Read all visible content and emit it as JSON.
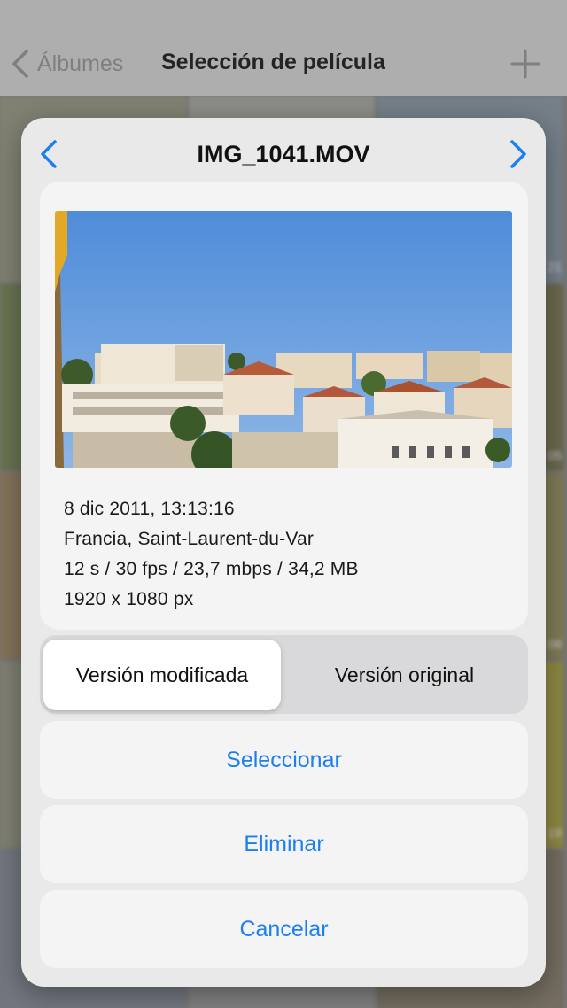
{
  "navbar": {
    "back_label": "Álbumes",
    "title": "Selección de película"
  },
  "background": {
    "labels": [
      "21",
      "05",
      "08",
      "19"
    ]
  },
  "modal": {
    "filename": "IMG_1041.MOV",
    "info": {
      "date": "8 dic 2011, 13:13:16",
      "location": "Francia, Saint-Laurent-du-Var",
      "specs": "12 s / 30 fps / 23,7 mbps / 34,2 MB",
      "resolution": "1920 x 1080 px"
    },
    "segmented": {
      "selected": "Versión modificada",
      "other": "Versión original"
    },
    "actions": {
      "select": "Seleccionar",
      "delete": "Eliminar",
      "cancel": "Cancelar"
    }
  },
  "colors": {
    "accent": "#1a7ff0",
    "sky": "#5a95db"
  },
  "icons": {
    "back": "chevron-left-icon",
    "add": "plus-icon",
    "prev": "chevron-left-icon",
    "next": "chevron-right-icon"
  }
}
